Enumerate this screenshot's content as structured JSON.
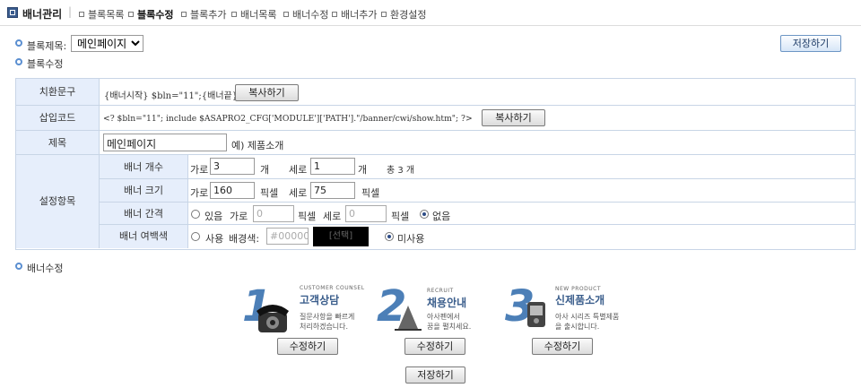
{
  "topnav": {
    "title": "배너관리",
    "items": [
      "블록목록",
      "블록수정",
      "블록추가",
      "배너목록",
      "배너수정",
      "배너추가",
      "환경설정"
    ],
    "active_index": 1
  },
  "block": {
    "title_label": "블록제목:",
    "title_select_value": "메인페이지",
    "edit_label": "블록수정",
    "save_top_label": "저장하기"
  },
  "table": {
    "substitute": {
      "label": "치환문구",
      "code": "{배너시작} $bln=\"11\";{배너끝}",
      "copy_label": "복사하기"
    },
    "insert": {
      "label": "삽입코드",
      "code": "<? $bln=\"11\";  include $ASAPRO2_CFG['MODULE']['PATH'].\"/banner/cwi/show.htm\";  ?>",
      "copy_label": "복사하기"
    },
    "title_row": {
      "label": "제목",
      "value": "메인페이지",
      "example": "예) 제품소개"
    },
    "settings": {
      "label": "설정항목",
      "count": {
        "label": "배너 개수",
        "h_label": "가로",
        "h_value": "3",
        "h_unit": "개",
        "v_label": "세로",
        "v_value": "1",
        "v_unit": "개",
        "total": "총 3 개"
      },
      "size": {
        "label": "배너 크기",
        "w_label": "가로",
        "w_value": "160",
        "w_unit": "픽셀",
        "h_label": "세로",
        "h_value": "75",
        "h_unit": "픽셀"
      },
      "gap": {
        "label": "배너 간격",
        "yes_label": "있음",
        "h_label": "가로",
        "h_value": "0",
        "h_unit": "픽셀",
        "v_label": "세로",
        "v_value": "0",
        "v_unit": "픽셀",
        "no_label": "없음",
        "selected": "no"
      },
      "margin_color": {
        "label": "배너 여백색",
        "use_label": "사용",
        "bg_label": "배경색:",
        "color_value": "#000000",
        "pick_label": "[선택]",
        "swatch_color": "#000000",
        "unused_label": "미사용",
        "selected": "unused"
      }
    }
  },
  "banner_edit_label": "배너수정",
  "banners": [
    {
      "num": "1",
      "sub": "CUSTOMER COUNSEL",
      "title": "고객상담",
      "desc1": "질문사항을 빠르게",
      "desc2": "처리하겠습니다.",
      "edit_label": "수정하기",
      "icon": "phone-icon"
    },
    {
      "num": "2",
      "sub": "RECRUIT",
      "title": "채용안내",
      "desc1": "아사펜에서",
      "desc2": "꿈을 펼치세요.",
      "edit_label": "수정하기",
      "icon": "recruit-icon"
    },
    {
      "num": "3",
      "sub": "NEW PRODUCT",
      "title": "신제품소개",
      "desc1": "아사 시리즈 특별제품",
      "desc2": "을 출시합니다.",
      "edit_label": "수정하기",
      "icon": "device-icon"
    }
  ],
  "save_bottom_label": "저장하기",
  "colors": {
    "accent": "#5b8fd1",
    "header_bg": "#e6eefb",
    "border": "#c8d5e6",
    "banner_num": "#4c7fb7"
  }
}
